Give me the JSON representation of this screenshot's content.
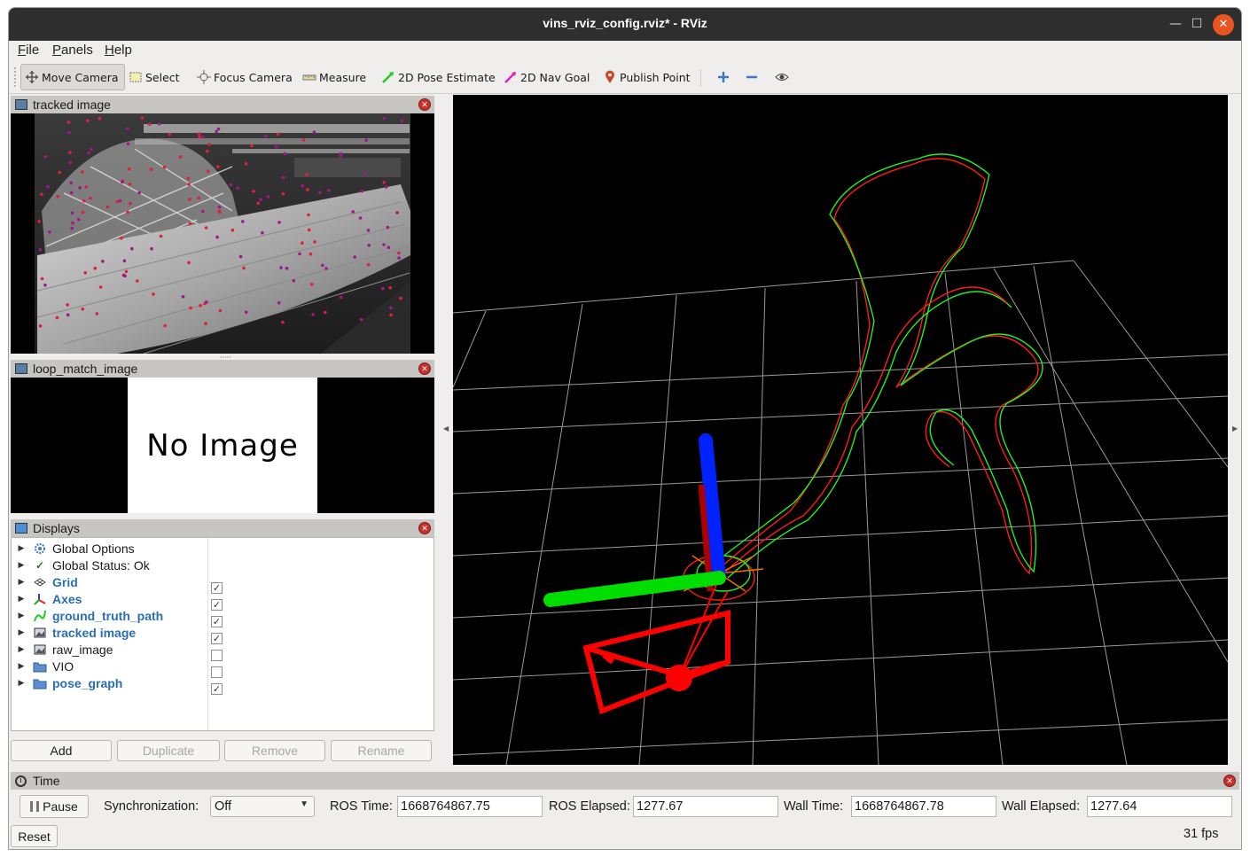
{
  "window": {
    "title": "vins_rviz_config.rviz* - RViz",
    "minimize": "—",
    "maximize": "☐",
    "close": "✕"
  },
  "menu": {
    "file": "File",
    "panels": "Panels",
    "help": "Help"
  },
  "toolbar": {
    "move_camera": "Move Camera",
    "select": "Select",
    "focus_camera": "Focus Camera",
    "measure": "Measure",
    "pose_estimate": "2D Pose Estimate",
    "nav_goal": "2D Nav Goal",
    "publish_point": "Publish Point"
  },
  "panels": {
    "tracked_image": "tracked image",
    "loop_match_image": "loop_match_image",
    "no_image": "No Image",
    "displays": "Displays"
  },
  "displays": {
    "items": [
      {
        "label": "Global Options",
        "icon": "gear-icon",
        "checkbox": null,
        "bold": false
      },
      {
        "label": "Global Status: Ok",
        "icon": "check-icon",
        "checkbox": null,
        "bold": false
      },
      {
        "label": "Grid",
        "icon": "grid-icon",
        "checkbox": true,
        "bold": true
      },
      {
        "label": "Axes",
        "icon": "axes-icon",
        "checkbox": true,
        "bold": true
      },
      {
        "label": "ground_truth_path",
        "icon": "path-icon",
        "checkbox": true,
        "bold": true
      },
      {
        "label": "tracked image",
        "icon": "image-icon",
        "checkbox": true,
        "bold": true
      },
      {
        "label": "raw_image",
        "icon": "image-icon",
        "checkbox": false,
        "bold": false
      },
      {
        "label": "VIO",
        "icon": "folder-icon",
        "checkbox": false,
        "bold": false
      },
      {
        "label": "pose_graph",
        "icon": "folder-icon",
        "checkbox": true,
        "bold": true
      }
    ],
    "buttons": {
      "add": "Add",
      "duplicate": "Duplicate",
      "remove": "Remove",
      "rename": "Rename"
    }
  },
  "time": {
    "title": "Time",
    "pause": "Pause",
    "sync_label": "Synchronization:",
    "sync_value": "Off",
    "ros_time_label": "ROS Time:",
    "ros_time": "1668764867.75",
    "ros_elapsed_label": "ROS Elapsed:",
    "ros_elapsed": "1277.67",
    "wall_time_label": "Wall Time:",
    "wall_time": "1668764867.78",
    "wall_elapsed_label": "Wall Elapsed:",
    "wall_elapsed": "1277.64",
    "reset": "Reset",
    "fps": "31 fps"
  },
  "colors": {
    "path_red": "#ff1a1a",
    "path_green": "#22ee22",
    "axis_x": "#ff0000",
    "axis_y": "#00dd00",
    "axis_z": "#0022ff",
    "link_blue": "#2a6fb3"
  }
}
